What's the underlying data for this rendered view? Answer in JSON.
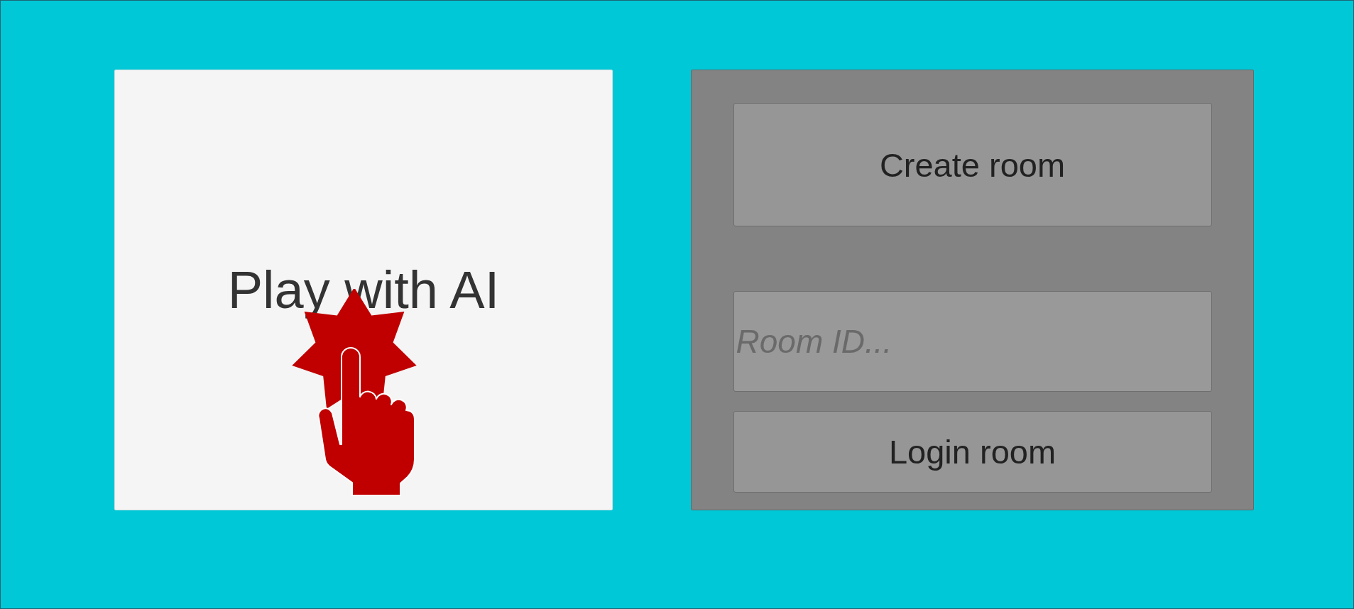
{
  "play_button": {
    "label": "Play with AI"
  },
  "room_panel": {
    "create_button": {
      "label": "Create room"
    },
    "room_id_field": {
      "placeholder": "Room ID..."
    },
    "login_button": {
      "label": "Login room"
    }
  }
}
